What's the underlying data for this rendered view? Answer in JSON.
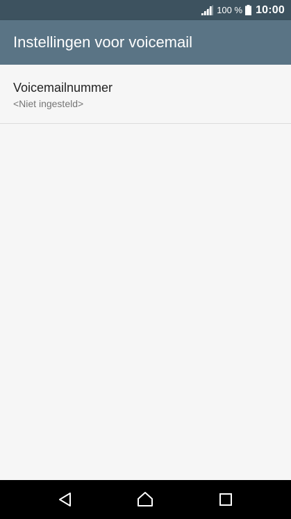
{
  "status_bar": {
    "battery_percent": "100 %",
    "time": "10:00",
    "signal_icon": "signal-icon",
    "battery_icon": "battery-icon"
  },
  "app_bar": {
    "title": "Instellingen voor voicemail"
  },
  "preferences": [
    {
      "title": "Voicemailnummer",
      "summary": "<Niet ingesteld>"
    }
  ],
  "nav_bar": {
    "back_icon": "back-icon",
    "home_icon": "home-icon",
    "recents_icon": "recents-icon"
  },
  "colors": {
    "status_bar": "#3d525f",
    "app_bar": "#5a7485",
    "background": "#f6f6f6",
    "nav_bar": "#000000"
  }
}
